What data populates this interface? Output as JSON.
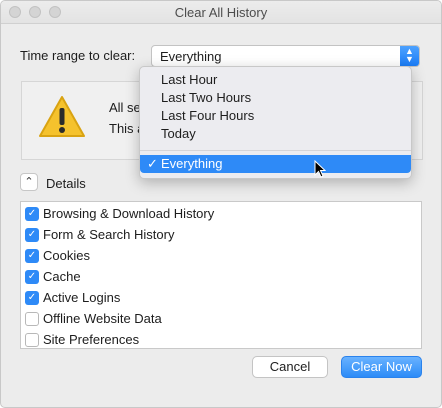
{
  "window": {
    "title": "Clear All History"
  },
  "range": {
    "label": "Time range to clear:",
    "selected": "Everything"
  },
  "message": {
    "line1": "All se",
    "line2": "This a"
  },
  "details": {
    "label": "Details"
  },
  "items": [
    {
      "label": "Browsing & Download History",
      "checked": true
    },
    {
      "label": "Form & Search History",
      "checked": true
    },
    {
      "label": "Cookies",
      "checked": true
    },
    {
      "label": "Cache",
      "checked": true
    },
    {
      "label": "Active Logins",
      "checked": true
    },
    {
      "label": "Offline Website Data",
      "checked": false
    },
    {
      "label": "Site Preferences",
      "checked": false
    }
  ],
  "buttons": {
    "cancel": "Cancel",
    "clear": "Clear Now"
  },
  "dropdown": {
    "options": [
      "Last Hour",
      "Last Two Hours",
      "Last Four Hours",
      "Today"
    ],
    "selected_option": "Everything"
  },
  "colors": {
    "accent": "#2e8af7",
    "warning": "#f5c22d"
  }
}
